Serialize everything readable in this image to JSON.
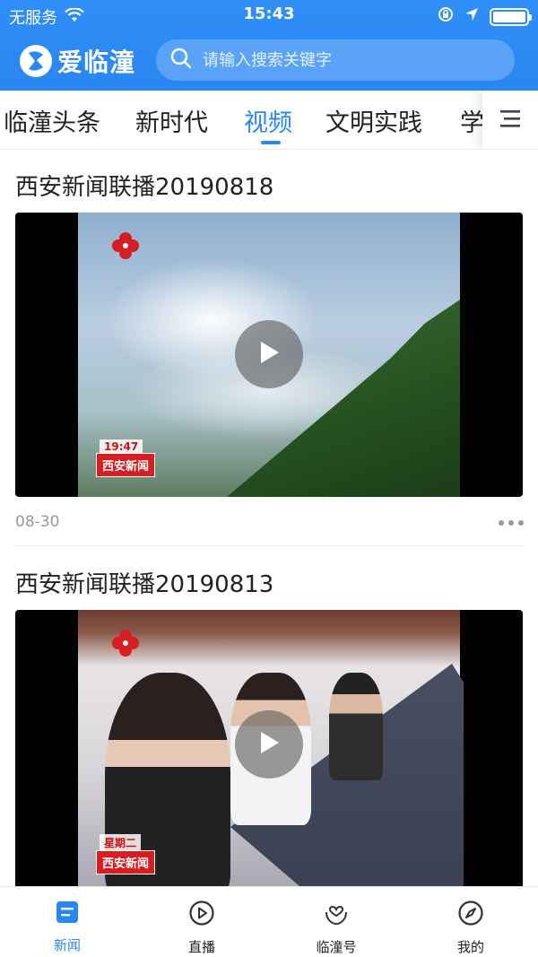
{
  "status_bar": {
    "carrier": "无服务",
    "time": "15:43"
  },
  "app": {
    "logo_text": "爱临潼",
    "search_placeholder": "请输入搜索关键字",
    "brand_color": "#2a86f2"
  },
  "tabs": [
    {
      "label": "临潼头条",
      "active": false
    },
    {
      "label": "新时代",
      "active": false
    },
    {
      "label": "视频",
      "active": true
    },
    {
      "label": "文明实践",
      "active": false
    },
    {
      "label": "学",
      "active": false
    }
  ],
  "feed": [
    {
      "title": "西安新闻联播20190818",
      "date": "08-30",
      "overlay_time": "19:47",
      "overlay_station": "西安新闻"
    },
    {
      "title": "西安新闻联播20190813",
      "overlay_weekday": "星期二",
      "overlay_station": "西安新闻"
    }
  ],
  "bottom_nav": [
    {
      "label": "新闻",
      "icon": "news-icon",
      "active": true
    },
    {
      "label": "直播",
      "icon": "play-circle-icon",
      "active": false
    },
    {
      "label": "临潼号",
      "icon": "heart-hands-icon",
      "active": false
    },
    {
      "label": "我的",
      "icon": "compass-icon",
      "active": false
    }
  ]
}
